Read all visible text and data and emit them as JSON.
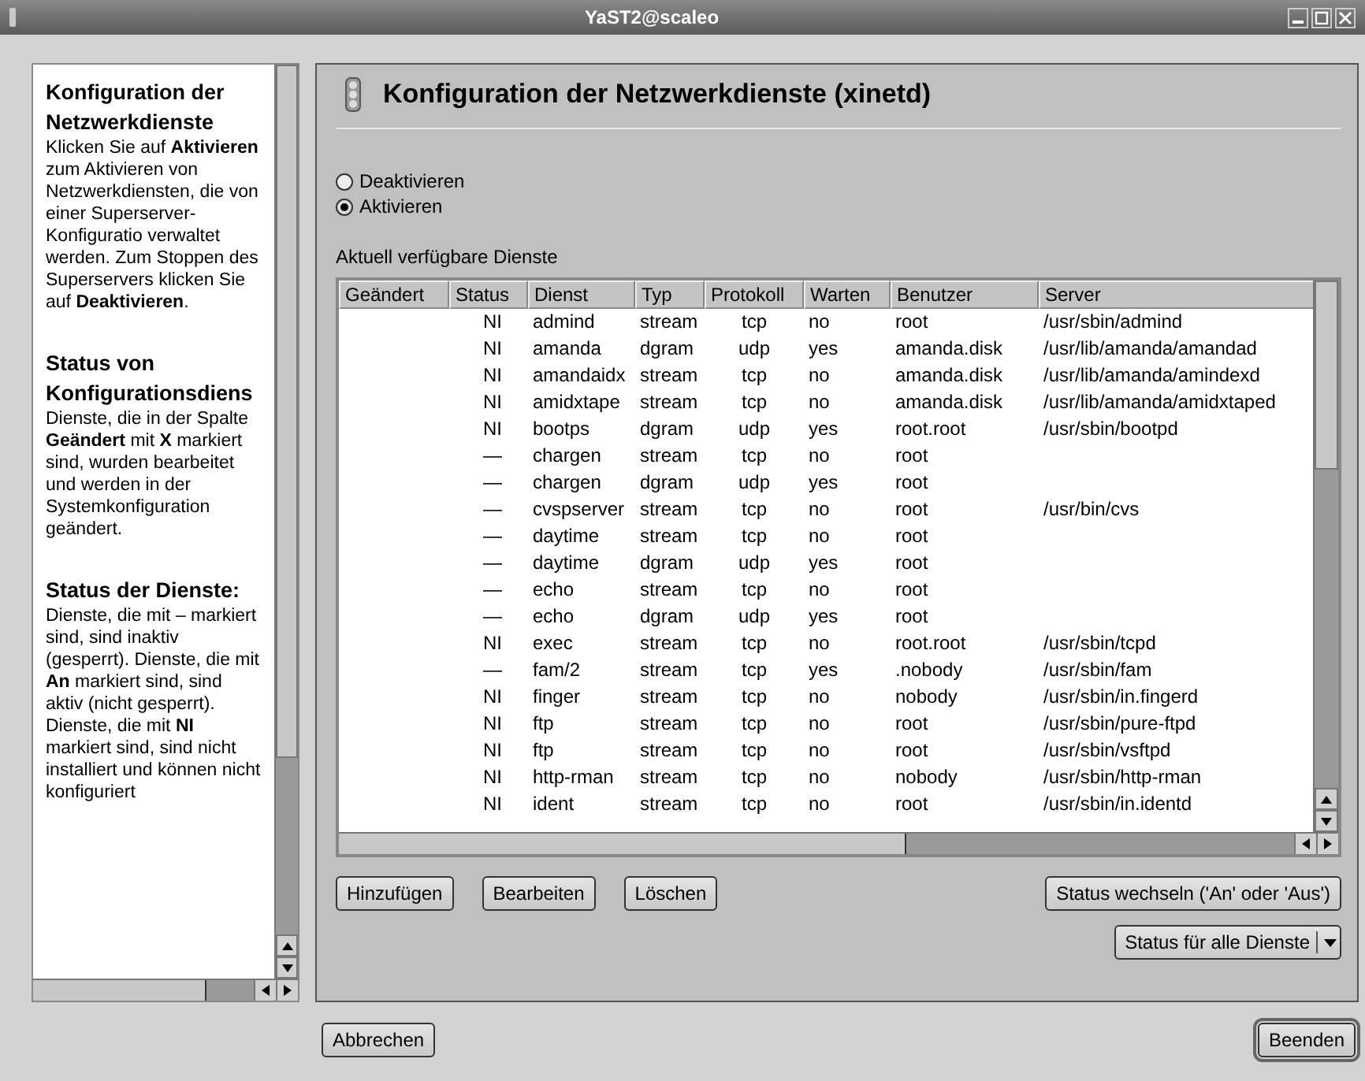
{
  "window": {
    "title": "YaST2@scaleo"
  },
  "help": [
    {
      "kind": "heading",
      "text": "Konfiguration der Netzwerkdienste"
    },
    {
      "kind": "paragraph",
      "text": "Klicken Sie auf **Aktivieren** zum Aktivieren von Netzwerkdiensten, die von einer Superserver-Konfiguratio verwaltet werden. Zum Stoppen des Superservers klicken Sie auf **Deaktivieren**."
    },
    {
      "kind": "heading",
      "text": "Status von Konfigurationsdiens"
    },
    {
      "kind": "paragraph",
      "text": "Dienste, die in der Spalte **Geändert** mit **X** markiert sind, wurden bearbeitet und werden in der Systemkonfiguration geändert."
    },
    {
      "kind": "heading",
      "text": "Status der Dienste:"
    },
    {
      "kind": "paragraph",
      "text": "Dienste, die mit – markiert sind, sind inaktiv (gesperrt). Dienste, die mit **An** markiert sind, sind aktiv (nicht gesperrt). Dienste, die mit **NI** markiert sind, sind nicht installiert und können nicht konfiguriert"
    }
  ],
  "dialog": {
    "title": "Konfiguration der Netzwerkdienste (xinetd)"
  },
  "mode": [
    {
      "label": "Deaktivieren",
      "selected": false
    },
    {
      "label": "Aktivieren",
      "selected": true
    }
  ],
  "table_label": "Aktuell verfügbare Dienste",
  "table": {
    "columns": [
      "Geändert",
      "Status",
      "Dienst",
      "Typ",
      "Protokoll",
      "Warten",
      "Benutzer",
      "Server"
    ],
    "rows": [
      {
        "status": "NI",
        "dienst": "admind",
        "typ": "stream",
        "protokoll": "tcp",
        "warten": "no",
        "benutzer": "root",
        "server": "/usr/sbin/admind"
      },
      {
        "status": "NI",
        "dienst": "amanda",
        "typ": "dgram",
        "protokoll": "udp",
        "warten": "yes",
        "benutzer": "amanda.disk",
        "server": "/usr/lib/amanda/amandad"
      },
      {
        "status": "NI",
        "dienst": "amandaidx",
        "typ": "stream",
        "protokoll": "tcp",
        "warten": "no",
        "benutzer": "amanda.disk",
        "server": "/usr/lib/amanda/amindexd"
      },
      {
        "status": "NI",
        "dienst": "amidxtape",
        "typ": "stream",
        "protokoll": "tcp",
        "warten": "no",
        "benutzer": "amanda.disk",
        "server": "/usr/lib/amanda/amidxtaped"
      },
      {
        "status": "NI",
        "dienst": "bootps",
        "typ": "dgram",
        "protokoll": "udp",
        "warten": "yes",
        "benutzer": "root.root",
        "server": "/usr/sbin/bootpd"
      },
      {
        "status": "—",
        "dienst": "chargen",
        "typ": "stream",
        "protokoll": "tcp",
        "warten": "no",
        "benutzer": "root"
      },
      {
        "status": "—",
        "dienst": "chargen",
        "typ": "dgram",
        "protokoll": "udp",
        "warten": "yes",
        "benutzer": "root"
      },
      {
        "status": "—",
        "dienst": "cvspserver",
        "typ": "stream",
        "protokoll": "tcp",
        "warten": "no",
        "benutzer": "root",
        "server": "/usr/bin/cvs"
      },
      {
        "status": "—",
        "dienst": "daytime",
        "typ": "stream",
        "protokoll": "tcp",
        "warten": "no",
        "benutzer": "root"
      },
      {
        "status": "—",
        "dienst": "daytime",
        "typ": "dgram",
        "protokoll": "udp",
        "warten": "yes",
        "benutzer": "root"
      },
      {
        "status": "—",
        "dienst": "echo",
        "typ": "stream",
        "protokoll": "tcp",
        "warten": "no",
        "benutzer": "root"
      },
      {
        "status": "—",
        "dienst": "echo",
        "typ": "dgram",
        "protokoll": "udp",
        "warten": "yes",
        "benutzer": "root"
      },
      {
        "status": "NI",
        "dienst": "exec",
        "typ": "stream",
        "protokoll": "tcp",
        "warten": "no",
        "benutzer": "root.root",
        "server": "/usr/sbin/tcpd"
      },
      {
        "status": "—",
        "dienst": "fam/2",
        "typ": "stream",
        "protokoll": "tcp",
        "warten": "yes",
        "benutzer": ".nobody",
        "server": "/usr/sbin/fam"
      },
      {
        "status": "NI",
        "dienst": "finger",
        "typ": "stream",
        "protokoll": "tcp",
        "warten": "no",
        "benutzer": "nobody",
        "server": "/usr/sbin/in.fingerd"
      },
      {
        "status": "NI",
        "dienst": "ftp",
        "typ": "stream",
        "protokoll": "tcp",
        "warten": "no",
        "benutzer": "root",
        "server": "/usr/sbin/pure-ftpd"
      },
      {
        "status": "NI",
        "dienst": "ftp",
        "typ": "stream",
        "protokoll": "tcp",
        "warten": "no",
        "benutzer": "root",
        "server": "/usr/sbin/vsftpd"
      },
      {
        "status": "NI",
        "dienst": "http-rman",
        "typ": "stream",
        "protokoll": "tcp",
        "warten": "no",
        "benutzer": "nobody",
        "server": "/usr/sbin/http-rman"
      },
      {
        "status": "NI",
        "dienst": "ident",
        "typ": "stream",
        "protokoll": "tcp",
        "warten": "no",
        "benutzer": "root",
        "server": "/usr/sbin/in.identd"
      }
    ]
  },
  "buttons": [
    "Hinzufügen",
    "Bearbeiten",
    "Löschen"
  ],
  "toggle_button": "Status wechseln ('An' oder 'Aus')",
  "menu_button": "Status für alle Dienste",
  "footer": {
    "cancel": "Abbrechen",
    "finish": "Beenden"
  }
}
